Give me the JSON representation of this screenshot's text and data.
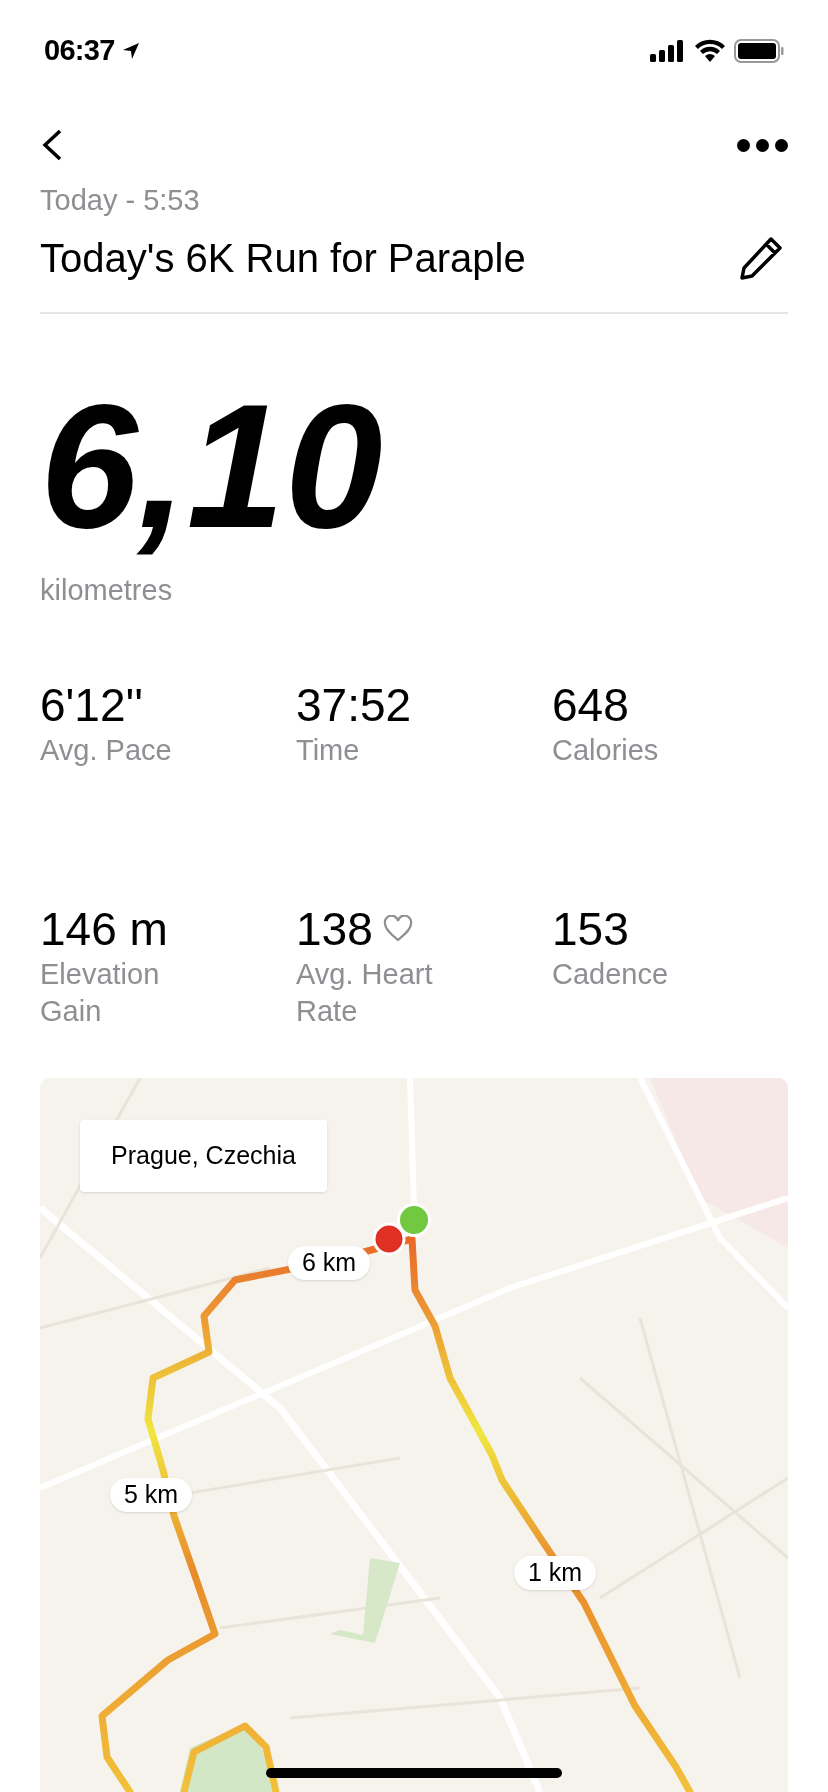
{
  "status_bar": {
    "time": "06:37"
  },
  "header": {
    "date": "Today - 5:53",
    "title": "Today's 6K Run for Paraple"
  },
  "distance": {
    "value": "6,10",
    "unit": "kilometres"
  },
  "stats": [
    {
      "kind": "plain",
      "value": "6'12''",
      "label": "Avg. Pace"
    },
    {
      "kind": "plain",
      "value": "37:52",
      "label": "Time"
    },
    {
      "kind": "plain",
      "value": "648",
      "label": "Calories"
    },
    {
      "kind": "plain",
      "value": "146 m",
      "label": "Elevation Gain"
    },
    {
      "kind": "heart",
      "value": "138",
      "label": "Avg. Heart Rate"
    },
    {
      "kind": "plain",
      "value": "153",
      "label": "Cadence"
    }
  ],
  "map": {
    "location": "Prague, Czechia",
    "km_labels": [
      "6 km",
      "5 km",
      "1 km"
    ]
  }
}
